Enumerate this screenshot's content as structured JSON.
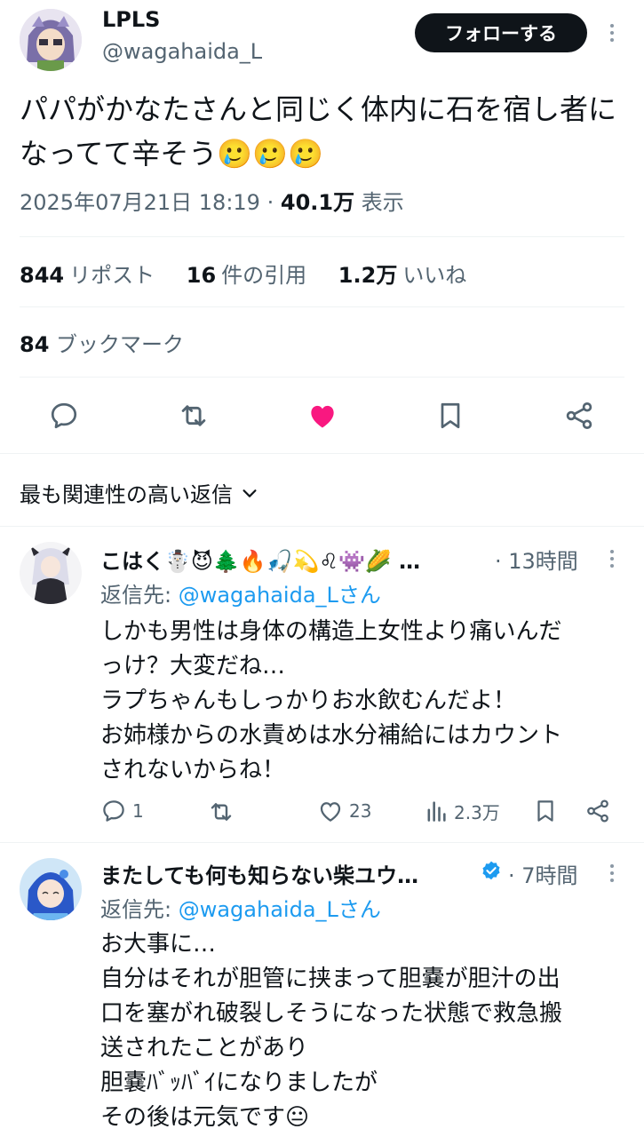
{
  "tweet": {
    "author_name": "LPLS",
    "author_handle": "@wagahaida_L",
    "follow_label": "フォローする",
    "text": "パパがかなたさんと同じく体内に石を宿し者になってて辛そう🥲🥲🥲",
    "date": "2025年07月21日 18:19",
    "separator": "·",
    "views": "40.1万",
    "views_label": "表示",
    "reposts": "844",
    "reposts_label": "リポスト",
    "quotes": "16",
    "quotes_label": "件の引用",
    "likes": "1.2万",
    "likes_label": "いいね",
    "bookmarks": "84",
    "bookmarks_label": "ブックマーク",
    "like_color": "#f91880"
  },
  "actions": [
    "reply-icon",
    "repost-icon",
    "like-icon",
    "bookmark-icon",
    "share-icon"
  ],
  "sort": {
    "label": "最も関連性の高い返信"
  },
  "replies": [
    {
      "name": "こはく☃️😈🌲🔥🎣💫♌👾🌽 …",
      "time": "· 13時間",
      "reply_to_prefix": "返信先: ",
      "reply_to_handle": "@wagahaida_L",
      "reply_to_suffix": "さん",
      "lines": [
        "しかも男性は身体の構造上女性より痛いんだ",
        "っけ？大変だね…",
        "ラプちゃんもしっかりお水飲むんだよ！",
        "お姉様からの水責めは水分補給にはカウント",
        "されないからね！"
      ],
      "reply_count": "1",
      "repost_count": "",
      "like_count": "23",
      "view_count": "2.3万"
    },
    {
      "name": "またしても何も知らない柴ユウ…",
      "verified": true,
      "time": "· 7時間",
      "reply_to_prefix": "返信先: ",
      "reply_to_handle": "@wagahaida_L",
      "reply_to_suffix": "さん",
      "lines": [
        "お大事に…",
        "自分はそれが胆管に挟まって胆嚢が胆汁の出",
        "口を塞がれ破裂しそうになった状態で救急搬",
        "送されたことがあり",
        "胆嚢ﾊﾞｯﾊﾞｲになりましたが",
        "その後は元気です😐"
      ]
    }
  ],
  "colors": {
    "accent": "#1d9bf0",
    "text": "#0f1419",
    "secondary": "#536471",
    "divider": "#eff3f4"
  }
}
